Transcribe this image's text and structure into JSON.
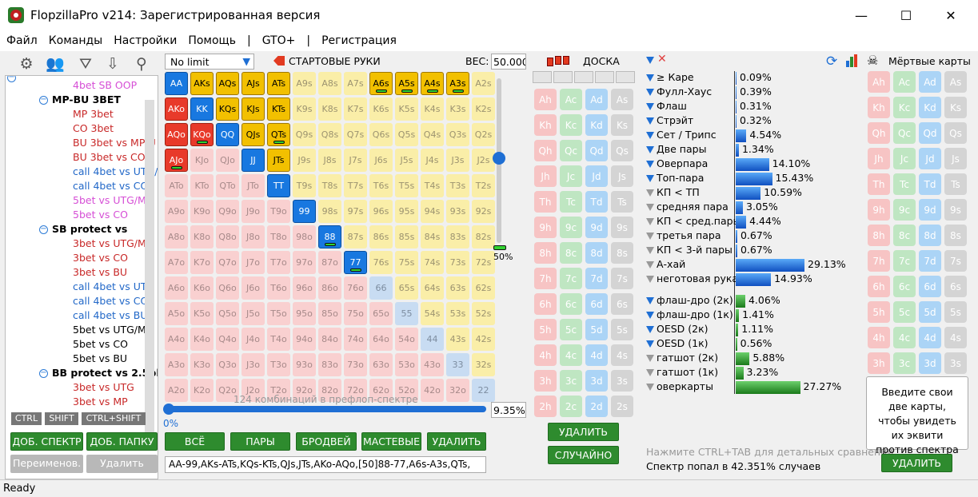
{
  "window": {
    "title": "FlopzillaPro v214: Зарегистрированная версия",
    "minimize": "—",
    "maximize": "☐",
    "close": "✕"
  },
  "menu": [
    "Файл",
    "Команды",
    "Настройки",
    "Помощь",
    "|",
    "GTO+",
    "|",
    "Регистрация"
  ],
  "tree": {
    "items": [
      {
        "text": "4bet SB OOP",
        "color": "pink",
        "level": 2
      },
      {
        "text": "MP-BU 3BET",
        "color": "head",
        "level": 1
      },
      {
        "text": "MP 3bet",
        "color": "red",
        "level": 2
      },
      {
        "text": "CO 3bet",
        "color": "red",
        "level": 2
      },
      {
        "text": "BU 3bet vs MP/U",
        "color": "red",
        "level": 2
      },
      {
        "text": "BU 3bet vs CO",
        "color": "red",
        "level": 2
      },
      {
        "text": "call 4bet vs UTG/",
        "color": "blue",
        "level": 2
      },
      {
        "text": "call 4bet vs CO",
        "color": "blue",
        "level": 2
      },
      {
        "text": "5bet vs UTG/MP",
        "color": "pink",
        "level": 2
      },
      {
        "text": "5bet vs CO",
        "color": "pink",
        "level": 2
      },
      {
        "text": "SB protect vs",
        "color": "head",
        "level": 1
      },
      {
        "text": "3bet vs UTG/MP",
        "color": "red",
        "level": 2
      },
      {
        "text": "3bet vs CO",
        "color": "red",
        "level": 2
      },
      {
        "text": "3bet vs BU",
        "color": "red",
        "level": 2
      },
      {
        "text": "call 4bet vs UTG",
        "color": "blue",
        "level": 2
      },
      {
        "text": "call 4bet vs CO",
        "color": "blue",
        "level": 2
      },
      {
        "text": "call 4bet vs BU",
        "color": "blue",
        "level": 2
      },
      {
        "text": "5bet vs UTG/MP",
        "color": "black",
        "level": 2
      },
      {
        "text": "5bet vs CO",
        "color": "black",
        "level": 2
      },
      {
        "text": "5bet vs BU",
        "color": "black",
        "level": 2
      },
      {
        "text": "BB protect vs 2.5bb",
        "color": "head",
        "level": 1
      },
      {
        "text": "3bet vs UTG",
        "color": "red",
        "level": 2
      },
      {
        "text": "3bet vs MP",
        "color": "red",
        "level": 2
      }
    ],
    "mod_tabs": [
      "CTRL",
      "SHIFT",
      "CTRL+SHIFT"
    ]
  },
  "left_buttons": {
    "add_range": "ДОБ. СПЕКТР",
    "add_folder": "ДОБ. ПАПКУ",
    "rename": "Переименов.",
    "delete": "Удалить"
  },
  "range": {
    "limit_select": "No limit",
    "start_hands_label": "СТАРТОВЫЕ РУКИ",
    "weight_label": "ВЕС:",
    "weight_value": "50.000",
    "slider_percent": "50%",
    "combos_text": "124 комбинаций в префлоп-спектре",
    "range_percent": "9.35%",
    "progress_label": "0%",
    "range_text": "AA-99,AKs-ATs,KQs-KTs,QJs,JTs,AKo-AQo,[50]88-77,A6s-A3s,QTs,",
    "buttons": [
      "ВСЁ",
      "ПАРЫ",
      "БРОДВЕЙ",
      "МАСТЕВЫЕ",
      "УДАЛИТЬ"
    ]
  },
  "grid": {
    "ranks": [
      "A",
      "K",
      "Q",
      "J",
      "T",
      "9",
      "8",
      "7",
      "6",
      "5",
      "4",
      "3",
      "2"
    ],
    "selected": [
      "AA",
      "AKs",
      "AQs",
      "AJs",
      "ATs",
      "KK",
      "KQs",
      "KJs",
      "KTs",
      "QQ",
      "QJs",
      "JJ",
      "JTs",
      "TT",
      "99",
      "88",
      "77",
      "AKo",
      "AQo",
      "KQo",
      "AJo",
      "A6s",
      "A5s",
      "A4s",
      "A3s",
      "QTs"
    ],
    "half": [
      "88",
      "77",
      "A6s",
      "A5s",
      "A4s",
      "A3s",
      "QTs",
      "AJo",
      "KQo"
    ]
  },
  "board": {
    "label": "ДОСКА",
    "delete": "УДАЛИТЬ",
    "random": "СЛУЧАЙНО"
  },
  "cards": {
    "rows": [
      "A",
      "K",
      "Q",
      "J",
      "T",
      "9",
      "8",
      "7",
      "6",
      "5",
      "4",
      "3",
      "2"
    ],
    "suits": [
      "h",
      "c",
      "d",
      "s"
    ]
  },
  "stats": {
    "made": [
      {
        "label": "≥ Каре",
        "value": "0.09%",
        "pct": 0.09
      },
      {
        "label": "Фулл-Хаус",
        "value": "0.39%",
        "pct": 0.39
      },
      {
        "label": "Флаш",
        "value": "0.31%",
        "pct": 0.31
      },
      {
        "label": "Стрэйт",
        "value": "0.32%",
        "pct": 0.32
      },
      {
        "label": "Сет / Трипс",
        "value": "4.54%",
        "pct": 4.54
      },
      {
        "label": "Две пары",
        "value": "1.34%",
        "pct": 1.34
      },
      {
        "label": "Оверпара",
        "value": "14.10%",
        "pct": 14.1
      },
      {
        "label": "Топ-пара",
        "value": "15.43%",
        "pct": 15.43
      },
      {
        "label": "КП < ТП",
        "value": "10.59%",
        "pct": 10.59
      },
      {
        "label": "средняя пара",
        "value": "3.05%",
        "pct": 3.05
      },
      {
        "label": "КП < сред.пары",
        "value": "4.44%",
        "pct": 4.44
      },
      {
        "label": "третья пара",
        "value": "0.67%",
        "pct": 0.67
      },
      {
        "label": "КП < 3-й пары",
        "value": "0.67%",
        "pct": 0.67
      },
      {
        "label": "А-хай",
        "value": "29.13%",
        "pct": 29.13
      },
      {
        "label": "неготовая рука",
        "value": "14.93%",
        "pct": 14.93
      }
    ],
    "draws": [
      {
        "label": "флаш-дро (2к)",
        "value": "4.06%",
        "pct": 4.06
      },
      {
        "label": "флаш-дро (1к)",
        "value": "1.41%",
        "pct": 1.41
      },
      {
        "label": "OESD (2к)",
        "value": "1.11%",
        "pct": 1.11
      },
      {
        "label": "OESD (1к)",
        "value": "0.56%",
        "pct": 0.56
      },
      {
        "label": "гатшот (2к)",
        "value": "5.88%",
        "pct": 5.88
      },
      {
        "label": "гатшот (1к)",
        "value": "3.23%",
        "pct": 3.23
      },
      {
        "label": "оверкарты",
        "value": "27.27%",
        "pct": 27.27
      }
    ],
    "hint": "Нажмите CTRL+TAB для детальных сравнений",
    "hit_text": "Спектр попал в 42.351% случаев"
  },
  "dead": {
    "label": "Мёртвые карты",
    "info": "Введите свои две карты, чтобы увидеть их эквити против спектра",
    "delete": "УДАЛИТЬ"
  },
  "status": "Ready"
}
